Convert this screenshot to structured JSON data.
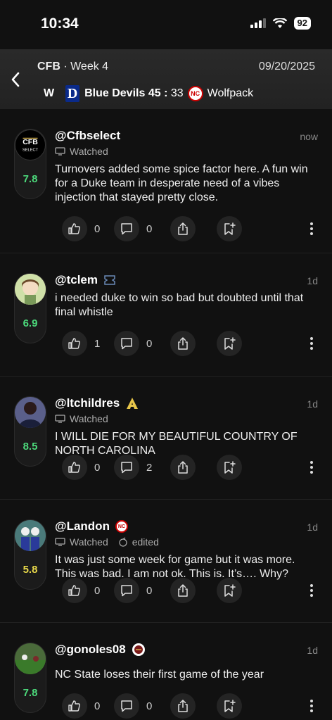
{
  "status": {
    "time": "10:34",
    "battery": "92"
  },
  "header": {
    "league": "CFB",
    "week": "Week 4",
    "date": "09/20/2025",
    "result": "W",
    "home_team": "Blue Devils",
    "home_score": "45",
    "separator": ":",
    "away_score": "33",
    "away_team": "Wolfpack"
  },
  "posts": [
    {
      "username": "@Cfbselect",
      "time": "now",
      "meta": "Watched",
      "edited": "",
      "rating": "7.8",
      "rating_color": "#4cd97b",
      "text": "Turnovers added some spice factor here. A fun win for a Duke team in desperate need of a vibes injection that stayed pretty close.",
      "likes": "0",
      "comments": "0"
    },
    {
      "username": "@tclem",
      "time": "1d",
      "meta": "",
      "edited": "",
      "rating": "6.9",
      "rating_color": "#4cd97b",
      "text": "i needed duke to win so bad but doubted until that final whistle",
      "likes": "1",
      "comments": "0"
    },
    {
      "username": "@ltchildres",
      "time": "1d",
      "meta": "Watched",
      "edited": "",
      "rating": "8.5",
      "rating_color": "#4cd97b",
      "text": "I WILL DIE FOR MY BEAUTIFUL COUNTRY OF NORTH CAROLINA",
      "likes": "0",
      "comments": "2"
    },
    {
      "username": "@Landon",
      "time": "1d",
      "meta": "Watched",
      "edited": "edited",
      "rating": "5.8",
      "rating_color": "#e8d84a",
      "text": "It was just some week for game but it was more. This was bad. I am not ok. This is. It’s…. Why?",
      "likes": "0",
      "comments": "0"
    },
    {
      "username": "@gonoles08",
      "time": "1d",
      "meta": "",
      "edited": "",
      "rating": "7.8",
      "rating_color": "#4cd97b",
      "text": "NC State loses their first game of the year",
      "likes": "0",
      "comments": "0"
    }
  ]
}
